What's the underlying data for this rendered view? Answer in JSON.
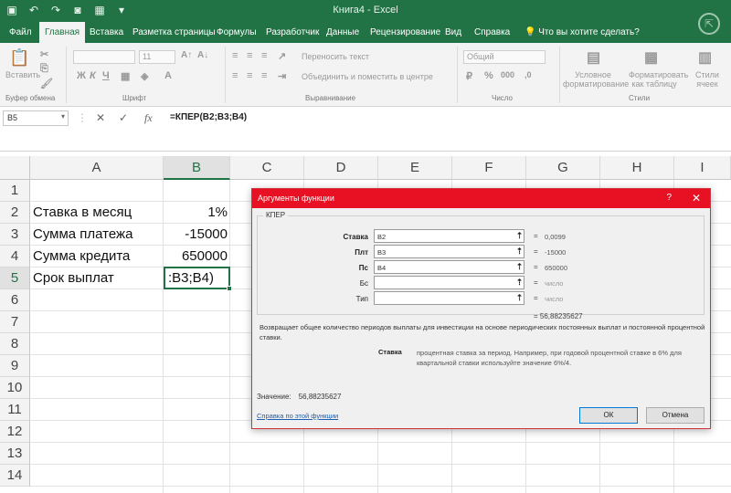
{
  "window": {
    "title": "Книга4 - Excel",
    "qat": [
      "save-icon",
      "undo-icon",
      "redo-icon",
      "camera-icon",
      "grid-icon",
      "customize-icon"
    ]
  },
  "ribbon": {
    "tabs": [
      {
        "label": "Файл"
      },
      {
        "label": "Главная"
      },
      {
        "label": "Вставка"
      },
      {
        "label": "Разметка страницы"
      },
      {
        "label": "Формулы"
      },
      {
        "label": "Разработчик"
      },
      {
        "label": "Данные"
      },
      {
        "label": "Рецензирование"
      },
      {
        "label": "Вид"
      },
      {
        "label": "Справка"
      },
      {
        "label": "Что вы хотите сделать?"
      }
    ],
    "active_tab": "Главная",
    "clipboard": {
      "paste": "Вставить",
      "group": "Буфер обмена"
    },
    "font": {
      "size": "11",
      "group": "Шрифт",
      "bold": "Ж",
      "italic": "К",
      "underline": "Ч"
    },
    "alignment": {
      "wrap": "Переносить текст",
      "merge": "Объединить и поместить в центре",
      "group": "Выравнивание"
    },
    "number": {
      "format": "Общий",
      "group": "Число",
      "percent": "%",
      "thousands": "000"
    },
    "styles": {
      "conditional": "Условное форматирование",
      "as_table": "Форматировать как таблицу",
      "cell_styles": "Стили ячеек",
      "group": "Стили"
    }
  },
  "formula_bar": {
    "name_box": "B5",
    "cancel": "✕",
    "enter": "✓",
    "fx": "fx",
    "formula": "=КПЕР(B2;B3;B4)"
  },
  "sheet": {
    "columns": [
      "A",
      "B",
      "C",
      "D",
      "E",
      "F",
      "G",
      "H",
      "I"
    ],
    "rows": [
      "1",
      "2",
      "3",
      "4",
      "5",
      "6",
      "7",
      "8",
      "9",
      "10",
      "11",
      "12",
      "13",
      "14"
    ],
    "selected_column": "B",
    "selected_row": "5",
    "cells": {
      "A2": "Ставка в месяц",
      "B2": "1%",
      "A3": "Сумма платежа",
      "B3": "-15000",
      "A4": "Сумма кредита",
      "B4": "650000",
      "A5": "Срок выплат",
      "B5": ":B3;B4)"
    }
  },
  "dialog": {
    "title": "Аргументы функции",
    "help": "?",
    "close": "✕",
    "function_name": "КПЕР",
    "args": [
      {
        "label": "Ставка",
        "value": "B2",
        "result": "0,0099",
        "required": true
      },
      {
        "label": "Плт",
        "value": "B3",
        "result": "-15000",
        "required": true
      },
      {
        "label": "Пс",
        "value": "B4",
        "result": "650000",
        "required": true
      },
      {
        "label": "Бс",
        "value": "",
        "result": "число",
        "required": false
      },
      {
        "label": "Тип",
        "value": "",
        "result": "число",
        "required": false
      }
    ],
    "formula_result": "56,88235627",
    "description": "Возвращает общее количество периодов выплаты для инвестиции на основе периодических постоянных выплат и постоянной процентной ставки.",
    "arg_desc_name": "Ставка",
    "arg_desc_text": "процентная ставка за период. Например, при годовой процентной ставке в 6% для квартальной ставки используйте значение 6%/4.",
    "value_label": "Значение:",
    "value": "56,88235627",
    "help_link": "Справка по этой функции",
    "ok": "ОК",
    "cancel": "Отмена"
  },
  "colors": {
    "excel_green": "#217346",
    "dialog_red": "#e81123"
  }
}
